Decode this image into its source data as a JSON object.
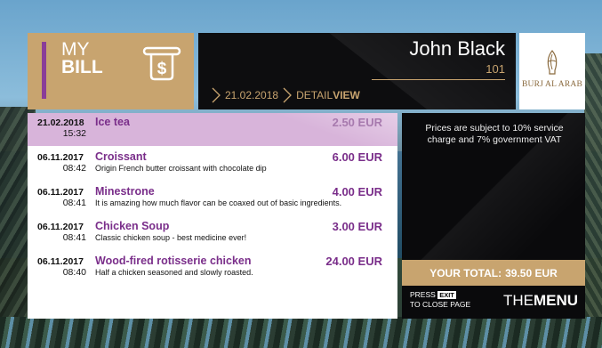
{
  "header": {
    "title_line1": "MY",
    "title_line2": "BILL",
    "guest_name": "John Black",
    "room": "101",
    "breadcrumb_date": "21.02.2018",
    "breadcrumb_detail": "DETAIL",
    "breadcrumb_view": "VIEW",
    "logo_text": "BURJ AL ARAB"
  },
  "items": [
    {
      "date": "21.02.2018",
      "time": "15:32",
      "name": "Ice tea",
      "desc": "",
      "price_int": "2.50",
      "price_cur": "EUR",
      "highlighted": true
    },
    {
      "date": "06.11.2017",
      "time": "08:42",
      "name": "Croissant",
      "desc": "Origin French butter croissant with chocolate dip",
      "price_int": "6.00",
      "price_cur": "EUR",
      "highlighted": false
    },
    {
      "date": "06.11.2017",
      "time": "08:41",
      "name": "Minestrone",
      "desc": "It is amazing how much flavor can be coaxed out of basic ingredients.",
      "price_int": "4.00",
      "price_cur": "EUR",
      "highlighted": false
    },
    {
      "date": "06.11.2017",
      "time": "08:41",
      "name": "Chicken Soup",
      "desc": "Classic chicken soup - best medicine ever!",
      "price_int": "3.00",
      "price_cur": "EUR",
      "highlighted": false
    },
    {
      "date": "06.11.2017",
      "time": "08:40",
      "name": "Wood-fired rotisserie chicken",
      "desc": "Half a chicken seasoned and slowly roasted.",
      "price_int": "24.00",
      "price_cur": "EUR",
      "highlighted": false
    }
  ],
  "side": {
    "notice": "Prices are subject to 10% service charge and 7% government VAT",
    "total_label": "YOUR TOTAL:",
    "total_value": "39.50 EUR",
    "press_label": "PRESS",
    "press_key": "EXIT",
    "press_action": "TO CLOSE PAGE",
    "brand_thin": "THE",
    "brand_bold": "MENU"
  },
  "colors": {
    "accent_gold": "#c8a46f",
    "accent_purple": "#7a2e8a",
    "highlight_row": "#d8b4da"
  },
  "icons": {
    "bill_icon": "receipt-dollar-icon",
    "breadcrumb_separator": "chevron-right-icon",
    "logo": "burj-al-arab-logo-icon"
  }
}
